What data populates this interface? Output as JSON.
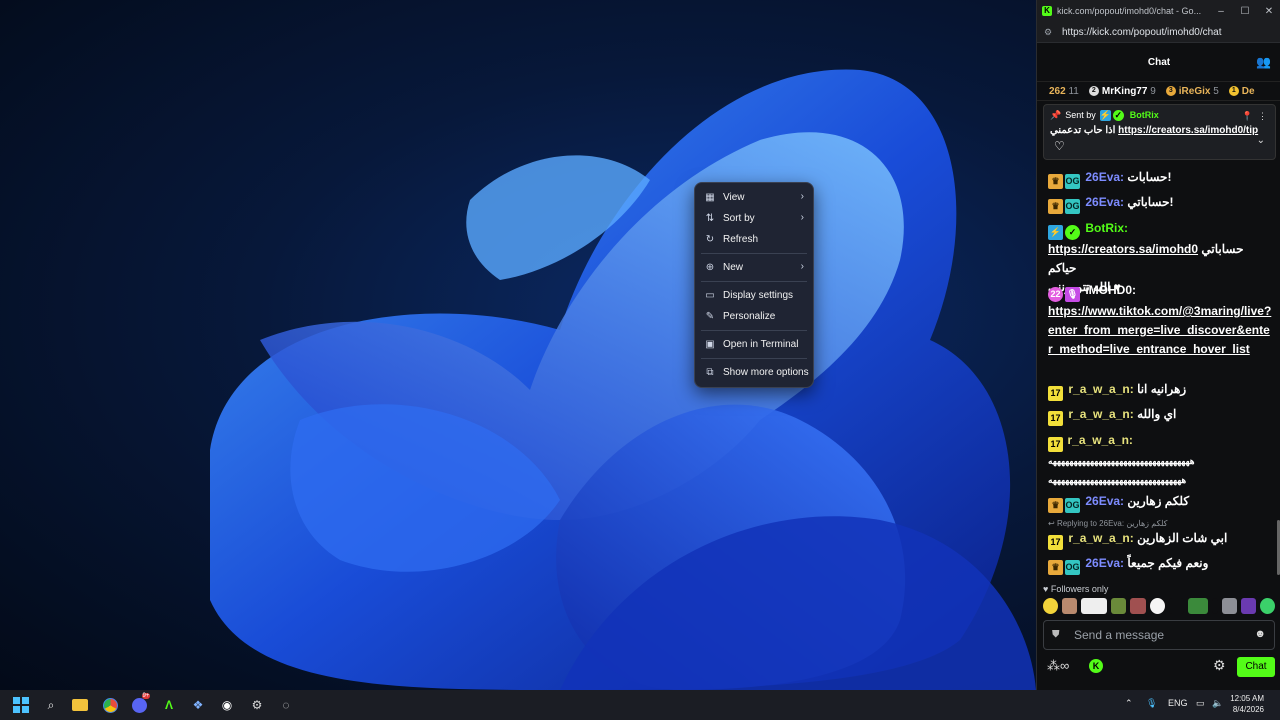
{
  "desktop": {
    "context_menu": {
      "items": [
        {
          "label": "View",
          "icon": "grid-icon",
          "submenu": true
        },
        {
          "label": "Sort by",
          "icon": "sort-icon",
          "submenu": true
        },
        {
          "label": "Refresh",
          "icon": "refresh-icon",
          "submenu": false
        },
        {
          "label": "New",
          "icon": "plus-circle-icon",
          "submenu": true
        },
        {
          "label": "Display settings",
          "icon": "display-icon",
          "submenu": false
        },
        {
          "label": "Personalize",
          "icon": "pen-icon",
          "submenu": false
        },
        {
          "label": "Open in Terminal",
          "icon": "terminal-icon",
          "submenu": false
        },
        {
          "label": "Show more options",
          "icon": "more-options-icon",
          "submenu": false
        }
      ]
    }
  },
  "window": {
    "title": "kick.com/popout/imohd0/chat - Go...",
    "url": "https://kick.com/popout/imohd0/chat",
    "chat_header": "Chat",
    "leaderboard": [
      {
        "rank_value": "262",
        "count": "11"
      },
      {
        "name": "MrKing77",
        "count": "9"
      },
      {
        "name": "iReGix",
        "count": "5"
      },
      {
        "name": "De",
        "count": ""
      }
    ],
    "pinned": {
      "sent_by_label": "Sent by",
      "sender": "BotRix",
      "text": "اذا حاب تدعمني",
      "link": "https://creators.sa/imohd0/tip"
    },
    "messages": [
      {
        "user": "26Eva:",
        "text": "حسابات!"
      },
      {
        "user": "26Eva:",
        "text": "حساباتي!"
      },
      {
        "user": "BotRix:",
        "link": "https://creators.sa/imohd0",
        "text": "حساباتي حياكم",
        "text2": "الله تتورونني ♥"
      },
      {
        "user": "iMOHD0:",
        "link": "https://www.tiktok.com/@3maring/live?",
        "link2": "enter_from_merge=live_discover&ente",
        "link3": "r_method=live_entrance_hover_list"
      },
      {
        "user": "r_a_w_a_n:",
        "text": "زهرانيه انا"
      },
      {
        "user": "r_a_w_a_n:",
        "text": "اي والله"
      },
      {
        "user": "r_a_w_a_n:",
        "text": "ههههههههههههههههههههههههههههههههههه",
        "text2": "ههههههههههههههههههههههههههههههههه"
      },
      {
        "user": "26Eva:",
        "text": "كلكم زهارين"
      },
      {
        "reply_label": "Replying to 26Eva:",
        "reply_text": "كلكم زهارين",
        "user": "r_a_w_a_n:",
        "text": "ابي شات الزهارين"
      },
      {
        "user": "26Eva:",
        "text": "ونعم فيكم جميعاً"
      }
    ],
    "followers_only": "Followers only",
    "input_placeholder": "Send a message",
    "send_button": "Chat"
  },
  "taskbar": {
    "discord_badge": "9+",
    "language": "ENG",
    "time": "12:05 AM",
    "date": "8/4/2026"
  },
  "colors": {
    "kick_green": "#53fc18",
    "taskbar_bg": "#1b1d24"
  }
}
